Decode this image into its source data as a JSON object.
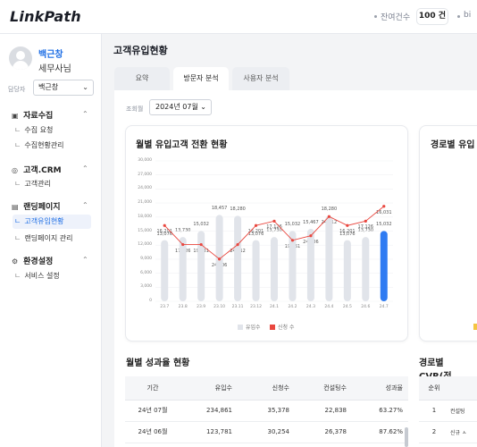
{
  "header": {
    "logo": "LinkPath",
    "balance_label": "잔여건수",
    "balance_value": "100 건",
    "extra_label": "bi"
  },
  "sidebar": {
    "user_name": "백근창",
    "user_role": "세무사님",
    "manager_label": "담당자",
    "manager_value": "백근창",
    "sections": [
      {
        "label": "자료수집",
        "icon": "box-icon",
        "items": [
          "수집 요청",
          "수집현황관리"
        ]
      },
      {
        "label": "고객.CRM",
        "icon": "crm-icon",
        "items": [
          "고객관리"
        ]
      },
      {
        "label": "랜딩페이지",
        "icon": "doc-icon",
        "items": [
          "고객유입현황",
          "랜딩페이지 관리"
        ]
      },
      {
        "label": "환경설정",
        "icon": "gear-icon",
        "items": [
          "서비스 설정"
        ]
      }
    ],
    "active_item": "고객유입현황"
  },
  "page": {
    "title": "고객유입현황",
    "tabs": [
      "요약",
      "방문자 분석",
      "사용자 분석"
    ],
    "active_tab": "방문자 분석",
    "period_label": "조회월",
    "period_value": "2024년 07월"
  },
  "chart_card": {
    "title": "월별 유입고객 전환 현황"
  },
  "right_card": {
    "title": "경로별 유입"
  },
  "chart_data": {
    "type": "bar",
    "categories": [
      "23.7",
      "23.8",
      "23.9",
      "23.10",
      "23.11",
      "23.12",
      "24.1",
      "24.2",
      "24.3",
      "24.4",
      "24.5",
      "24.6",
      "24.7"
    ],
    "ylim": [
      0,
      30000
    ],
    "yticks": [
      "30,000",
      "27,000",
      "24,000",
      "21,000",
      "18,000",
      "15,000",
      "12,000",
      "9,000",
      "6,000",
      "3,000",
      "0"
    ],
    "series": [
      {
        "name": "유입수",
        "type": "bar",
        "color": "#e1e4ea",
        "highlight_color": "#2f7bf2",
        "values": [
          13076,
          13730,
          15032,
          18457,
          18280,
          13076,
          13730,
          15032,
          15467,
          18280,
          13076,
          13730,
          15032
        ],
        "labels": [
          "13,076",
          "13,730",
          "15,032",
          "18,457",
          "18,280",
          "13,076",
          "13,730",
          "15,032",
          "15,467",
          "18,280",
          "13,076",
          "13,730",
          "15,032"
        ]
      },
      {
        "name": "신청 수",
        "type": "line",
        "color": "#e9473f",
        "values": [
          16201,
          12126,
          12126,
          9031,
          12112,
          16201,
          17126,
          13031,
          14006,
          18112,
          16201,
          17126,
          20301
        ],
        "labels": [
          "16,201",
          "17,126",
          "19,031",
          "24,006",
          "24,112",
          "16,201",
          "17,126",
          "19,031",
          "24,006",
          "24,112",
          "16,201",
          "17,126",
          "16,031"
        ]
      }
    ],
    "legend_position": "bottom"
  },
  "perf_section": {
    "title": "월별 성과율 현황",
    "columns": [
      "기간",
      "유입수",
      "신청수",
      "컨설팅수",
      "성과율"
    ],
    "rows": [
      [
        "24년 07월",
        "234,861",
        "35,378",
        "22,838",
        "63.27%"
      ],
      [
        "24년 06월",
        "123,781",
        "30,254",
        "26,378",
        "87.62%"
      ]
    ]
  },
  "cvr_section": {
    "title": "경로별 CVR(전",
    "columns": [
      "순위",
      ""
    ],
    "rows": [
      [
        "1",
        "컨설팅"
      ],
      [
        "2",
        "신규 ㅅ"
      ]
    ]
  },
  "colors": {
    "accent": "#1f6fe5",
    "bar": "#e1e4ea",
    "bar_highlight": "#2f7bf2",
    "line": "#e9473f"
  }
}
